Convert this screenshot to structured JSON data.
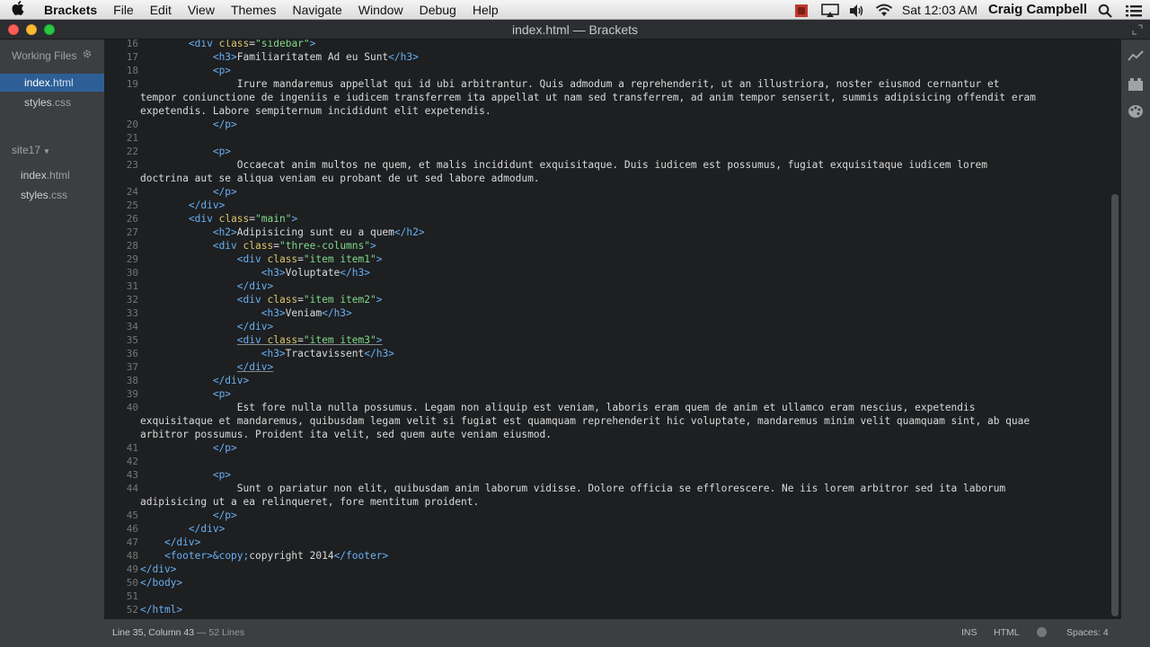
{
  "menubar": {
    "app_name": "Brackets",
    "items": [
      "File",
      "Edit",
      "View",
      "Themes",
      "Navigate",
      "Window",
      "Debug",
      "Help"
    ],
    "clock": "Sat 12:03 AM",
    "user": "Craig Campbell",
    "status_icons": [
      "record-icon",
      "airplay-icon",
      "volume-icon",
      "wifi-icon",
      "search-icon",
      "list-icon"
    ]
  },
  "window": {
    "title": "index.html — Brackets"
  },
  "sidebar": {
    "working_files_label": "Working Files",
    "working_files": [
      {
        "name": "index",
        "ext": ".html",
        "selected": true
      },
      {
        "name": "styles",
        "ext": ".css",
        "selected": false
      }
    ],
    "project_name": "site17",
    "project_files": [
      {
        "name": "index",
        "ext": ".html"
      },
      {
        "name": "styles",
        "ext": ".css"
      }
    ]
  },
  "editor": {
    "lines": [
      {
        "num": "16",
        "html": "        <span class=\"tag\">&lt;div</span> <span class=\"attr\">class</span>=<span class=\"str\">\"sidebar\"</span><span class=\"tag\">&gt;</span>"
      },
      {
        "num": "17",
        "html": "            <span class=\"tag\">&lt;h3&gt;</span>Familiaritatem Ad eu Sunt<span class=\"tag\">&lt;/h3&gt;</span>"
      },
      {
        "num": "18",
        "html": "            <span class=\"tag\">&lt;p&gt;</span>"
      },
      {
        "num": "19",
        "html": "                Irure mandaremus appellat qui id ubi arbitrantur. Quis admodum a reprehenderit, ut an illustriora, noster eiusmod cernantur et"
      },
      {
        "num": "",
        "html": "tempor coniunctione de ingeniis e iudicem transferrem ita appellat ut nam sed transferrem, ad anim tempor senserit, summis adipisicing offendit eram"
      },
      {
        "num": "",
        "html": "expetendis. Labore sempiternum incididunt elit expetendis."
      },
      {
        "num": "20",
        "html": "            <span class=\"tag\">&lt;/p&gt;</span>"
      },
      {
        "num": "21",
        "html": ""
      },
      {
        "num": "22",
        "html": "            <span class=\"tag\">&lt;p&gt;</span>"
      },
      {
        "num": "23",
        "html": "                Occaecat anim multos ne quem, et malis incididunt exquisitaque. Duis iudicem est possumus, fugiat exquisitaque iudicem lorem"
      },
      {
        "num": "",
        "html": "doctrina aut se aliqua veniam eu probant de ut sed labore admodum."
      },
      {
        "num": "24",
        "html": "            <span class=\"tag\">&lt;/p&gt;</span>"
      },
      {
        "num": "25",
        "html": "        <span class=\"tag\">&lt;/div&gt;</span>"
      },
      {
        "num": "26",
        "html": "        <span class=\"tag\">&lt;div</span> <span class=\"attr\">class</span>=<span class=\"str\">\"main\"</span><span class=\"tag\">&gt;</span>"
      },
      {
        "num": "27",
        "html": "            <span class=\"tag\">&lt;h2&gt;</span>Adipisicing sunt eu a quem<span class=\"tag\">&lt;/h2&gt;</span>"
      },
      {
        "num": "28",
        "html": "            <span class=\"tag\">&lt;div</span> <span class=\"attr\">class</span>=<span class=\"str\">\"three-columns\"</span><span class=\"tag\">&gt;</span>"
      },
      {
        "num": "29",
        "html": "                <span class=\"tag\">&lt;div</span> <span class=\"attr\">class</span>=<span class=\"str\">\"item item1\"</span><span class=\"tag\">&gt;</span>"
      },
      {
        "num": "30",
        "html": "                    <span class=\"tag\">&lt;h3&gt;</span>Voluptate<span class=\"tag\">&lt;/h3&gt;</span>"
      },
      {
        "num": "31",
        "html": "                <span class=\"tag\">&lt;/div&gt;</span>"
      },
      {
        "num": "32",
        "html": "                <span class=\"tag\">&lt;div</span> <span class=\"attr\">class</span>=<span class=\"str\">\"item item2\"</span><span class=\"tag\">&gt;</span>"
      },
      {
        "num": "33",
        "html": "                    <span class=\"tag\">&lt;h3&gt;</span>Veniam<span class=\"tag\">&lt;/h3&gt;</span>"
      },
      {
        "num": "34",
        "html": "                <span class=\"tag\">&lt;/div&gt;</span>"
      },
      {
        "num": "35",
        "html": "                <span class=\"under\"><span class=\"tag\">&lt;div</span> <span class=\"attr\">class</span>=<span class=\"str\">\"item item3\"</span><span class=\"tag\">&gt;</span></span>"
      },
      {
        "num": "36",
        "html": "                    <span class=\"tag\">&lt;h3&gt;</span>Tractavissent<span class=\"tag\">&lt;/h3&gt;</span>"
      },
      {
        "num": "37",
        "html": "                <span class=\"under\"><span class=\"tag\">&lt;/div&gt;</span></span>"
      },
      {
        "num": "38",
        "html": "            <span class=\"tag\">&lt;/div&gt;</span>"
      },
      {
        "num": "39",
        "html": "            <span class=\"tag\">&lt;p&gt;</span>"
      },
      {
        "num": "40",
        "html": "                Est fore nulla nulla possumus. Legam non aliquip est veniam, laboris eram quem de anim et ullamco eram nescius, expetendis"
      },
      {
        "num": "",
        "html": "exquisitaque et mandaremus, quibusdam legam velit si fugiat est quamquam reprehenderit hic voluptate, mandaremus minim velit quamquam sint, ab quae"
      },
      {
        "num": "",
        "html": "arbitror possumus. Proident ita velit, sed quem aute veniam eiusmod."
      },
      {
        "num": "41",
        "html": "            <span class=\"tag\">&lt;/p&gt;</span>"
      },
      {
        "num": "42",
        "html": ""
      },
      {
        "num": "43",
        "html": "            <span class=\"tag\">&lt;p&gt;</span>"
      },
      {
        "num": "44",
        "html": "                Sunt o pariatur non elit, quibusdam anim laborum vidisse. Dolore officia se efflorescere. Ne iis lorem arbitror sed ita laborum"
      },
      {
        "num": "",
        "html": "adipisicing ut a ea relinqueret, fore mentitum proident."
      },
      {
        "num": "45",
        "html": "            <span class=\"tag\">&lt;/p&gt;</span>"
      },
      {
        "num": "46",
        "html": "        <span class=\"tag\">&lt;/div&gt;</span>"
      },
      {
        "num": "47",
        "html": "    <span class=\"tag\">&lt;/div&gt;</span>"
      },
      {
        "num": "48",
        "html": "    <span class=\"tag\">&lt;footer&gt;</span><span class=\"ent\">&amp;copy;</span>copyright 2014<span class=\"tag\">&lt;/footer&gt;</span>"
      },
      {
        "num": "49",
        "html": "<span class=\"tag\">&lt;/div&gt;</span>"
      },
      {
        "num": "50",
        "html": "<span class=\"tag\">&lt;/body&gt;</span>"
      },
      {
        "num": "51",
        "html": ""
      },
      {
        "num": "52",
        "html": "<span class=\"tag\">&lt;/html&gt;</span>"
      }
    ]
  },
  "statusbar": {
    "position": "Line 35, Column 43",
    "lines_count": "— 52 Lines",
    "mode": "INS",
    "language": "HTML",
    "spaces": "Spaces: 4"
  },
  "colors": {
    "editor_bg": "#1d1f21",
    "sidebar_bg": "#3c3f41",
    "selection": "#2d5f96",
    "tag": "#6ab0f3",
    "attr": "#e0c46c",
    "string": "#7fd98b"
  }
}
